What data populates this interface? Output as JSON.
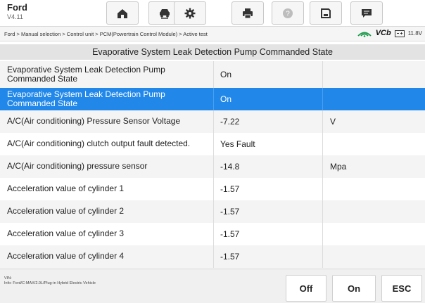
{
  "header": {
    "brand": "Ford",
    "version": "V4.11"
  },
  "toolbar": [
    {
      "icon": "home-icon"
    },
    {
      "icon": "vehicle-swap-icon"
    },
    {
      "icon": "settings-gear-icon"
    },
    {
      "icon": "print-icon"
    },
    {
      "icon": "help-icon"
    },
    {
      "icon": "save-icon"
    },
    {
      "icon": "message-icon"
    }
  ],
  "breadcrumb": "Ford > Manual selection > Control unit > PCM(Powertrain Control Module) > Active test",
  "vci": {
    "label": "VCb",
    "voltage": "11.8V"
  },
  "section_title": "Evaporative System Leak Detection Pump Commanded State",
  "rows": [
    {
      "name": "Evaporative System Leak Detection Pump Commanded State",
      "value": "On",
      "unit": ""
    },
    {
      "name": "Evaporative System Leak Detection Pump Commanded State",
      "value": "On",
      "unit": ""
    },
    {
      "name": "A/C(Air conditioning) Pressure Sensor Voltage",
      "value": "-7.22",
      "unit": "V"
    },
    {
      "name": "A/C(Air conditioning) clutch output fault detected.",
      "value": "Yes Fault",
      "unit": ""
    },
    {
      "name": "A/C(Air conditioning) pressure sensor",
      "value": "-14.8",
      "unit": "Mpa"
    },
    {
      "name": "Acceleration value of cylinder 1",
      "value": "-1.57",
      "unit": ""
    },
    {
      "name": "Acceleration value of cylinder 2",
      "value": "-1.57",
      "unit": ""
    },
    {
      "name": "Acceleration value of cylinder 3",
      "value": "-1.57",
      "unit": ""
    },
    {
      "name": "Acceleration value of cylinder 4",
      "value": "-1.57",
      "unit": ""
    }
  ],
  "selected_row": 1,
  "footer": {
    "vin_label": "VIN:",
    "info": "Info: Ford/C-MAX/2.0L/Plug-in Hybrid Electric Vehicle",
    "buttons": [
      "Off",
      "On",
      "ESC"
    ]
  },
  "colors": {
    "selected_row": "#2187e9"
  }
}
